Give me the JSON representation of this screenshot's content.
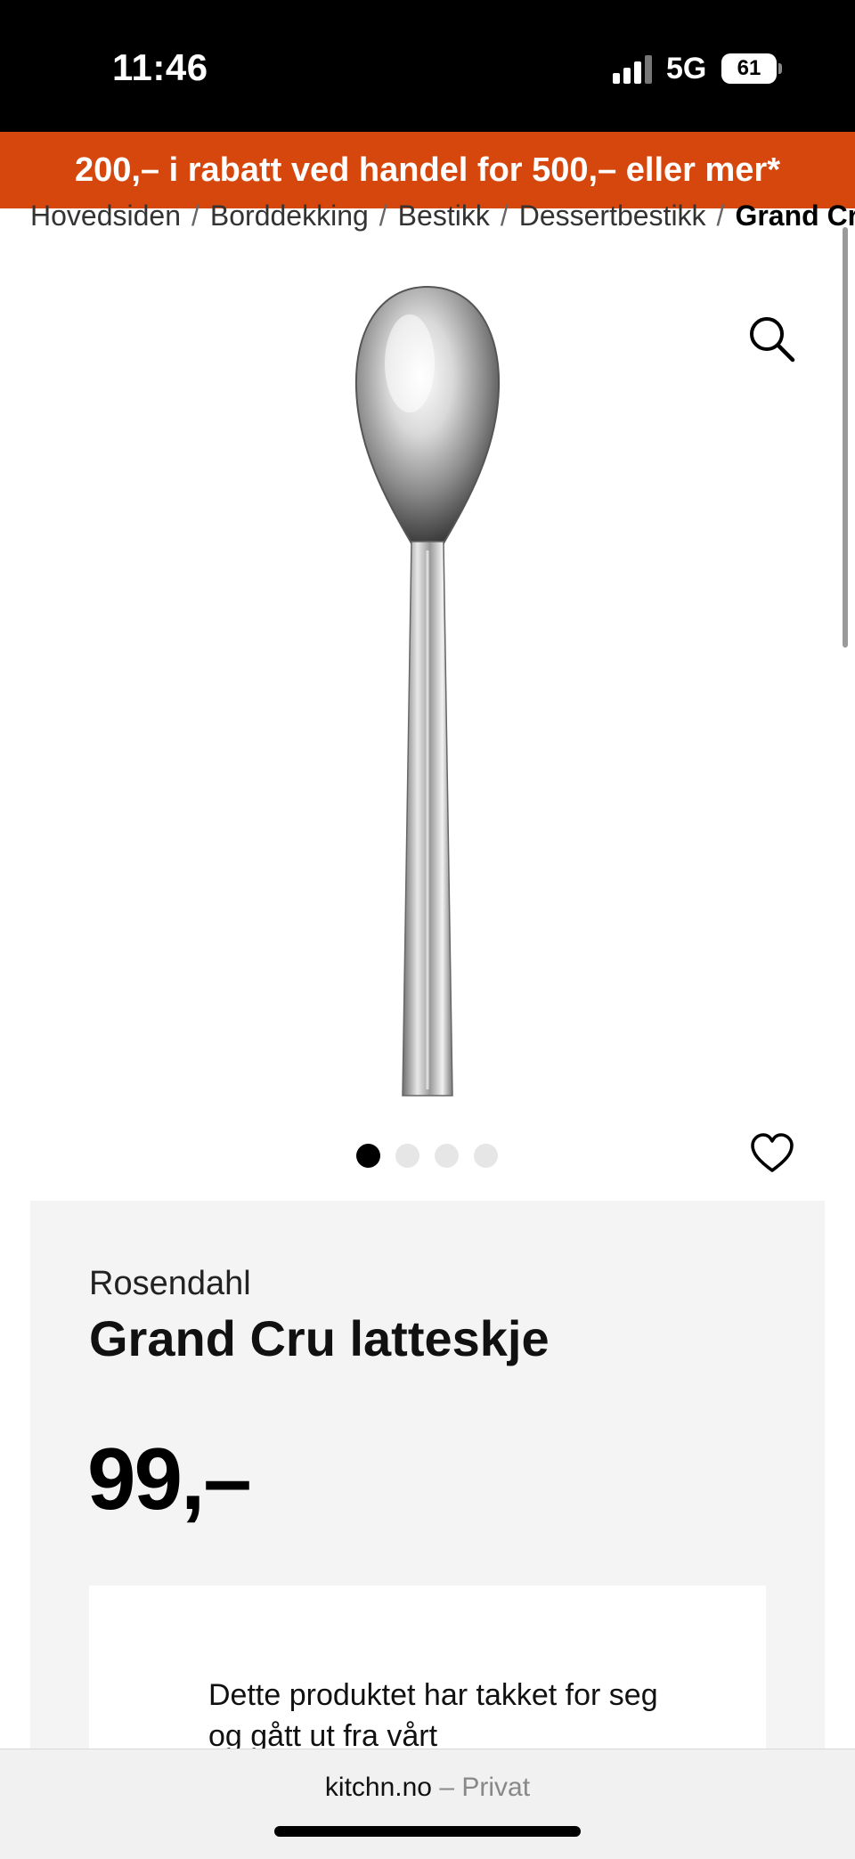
{
  "status_bar": {
    "time": "11:46",
    "network": "5G",
    "battery": "61"
  },
  "promo": {
    "text": "200,– i rabatt ved handel for 500,– eller mer*",
    "color": "#d6470e"
  },
  "breadcrumb": {
    "items": [
      "Hovedsiden",
      "Borddekking",
      "Bestikk",
      "Dessertbestikk"
    ],
    "current": "Grand Cru latteskje",
    "separator": "/"
  },
  "gallery": {
    "dot_count": 4,
    "active_index": 0,
    "icons": {
      "zoom": "search-icon",
      "favorite": "heart-icon"
    }
  },
  "product": {
    "brand": "Rosendahl",
    "title": "Grand Cru latteskje",
    "price": "99,–",
    "notice": "Dette produktet har takket for seg og gått ut fra vårt"
  },
  "browser": {
    "domain": "kitchn.no",
    "mode": "– Privat"
  }
}
